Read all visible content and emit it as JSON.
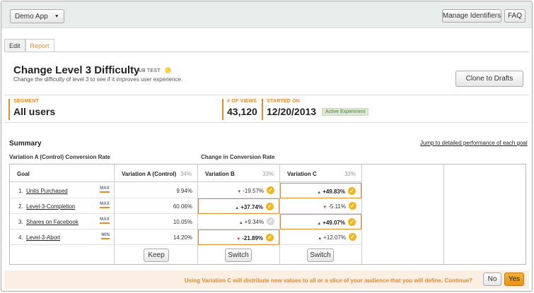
{
  "topbar": {
    "app_select": "Demo App",
    "manage_identifiers": "Manage Identifiers",
    "faq": "FAQ"
  },
  "tabs": [
    {
      "label": "Edit"
    },
    {
      "label": "Report"
    }
  ],
  "experiment": {
    "title": "Change Level 3 Difficulty",
    "type_tag": "A/B TEST",
    "description": "Change the difficulty of level 3 to see if it improves user experience.",
    "clone_button": "Clone to Drafts"
  },
  "stats": {
    "segment_label": "SEGMENT",
    "segment_value": "All users",
    "views_label": "# OF VIEWS",
    "views_value": "43,120",
    "started_label": "STARTED ON",
    "started_value": "12/20/2013",
    "status_badge": "Active Experiment"
  },
  "summary": {
    "title": "Summary",
    "jump_link": "Jump to detailed performance of each goal",
    "control_rate_label": "Variation A (Control) Conversion Rate",
    "change_label": "Change in Conversion Rate"
  },
  "table": {
    "goal_header": "Goal",
    "goals": [
      {
        "num": "1.",
        "name": "Units Purchased",
        "target": "MAX"
      },
      {
        "num": "2.",
        "name": "Level-3-Completion",
        "target": "MAX"
      },
      {
        "num": "3.",
        "name": "Shares on Facebook",
        "target": "MAX"
      },
      {
        "num": "4.",
        "name": "Level-3-Abort",
        "target": "MIN"
      }
    ],
    "variation_a": {
      "name": "Variation A (Control)",
      "pct": "34%",
      "values": [
        "9.94%",
        "60.06%",
        "10.05%",
        "14.20%"
      ],
      "button": "Keep"
    },
    "variation_b": {
      "name": "Variation B",
      "pct": "33%",
      "values": [
        "-19.57%",
        "+37.74%",
        "+9.34%",
        "-21.89%"
      ],
      "button": "Switch"
    },
    "variation_c": {
      "name": "Variation C",
      "pct": "33%",
      "values": [
        "+49.83%",
        "-5.11%",
        "+49.07%",
        "+12.07%"
      ],
      "button": "Switch"
    }
  },
  "footer": {
    "message": "Using Variation C will distribute new values to all or a slice of your audience that you will define. Continue?",
    "no": "No",
    "yes": "Yes"
  },
  "colors": {
    "accent": "#e58b2b",
    "topbar_bg": "#e8ecea",
    "check": "#f2b51e"
  }
}
